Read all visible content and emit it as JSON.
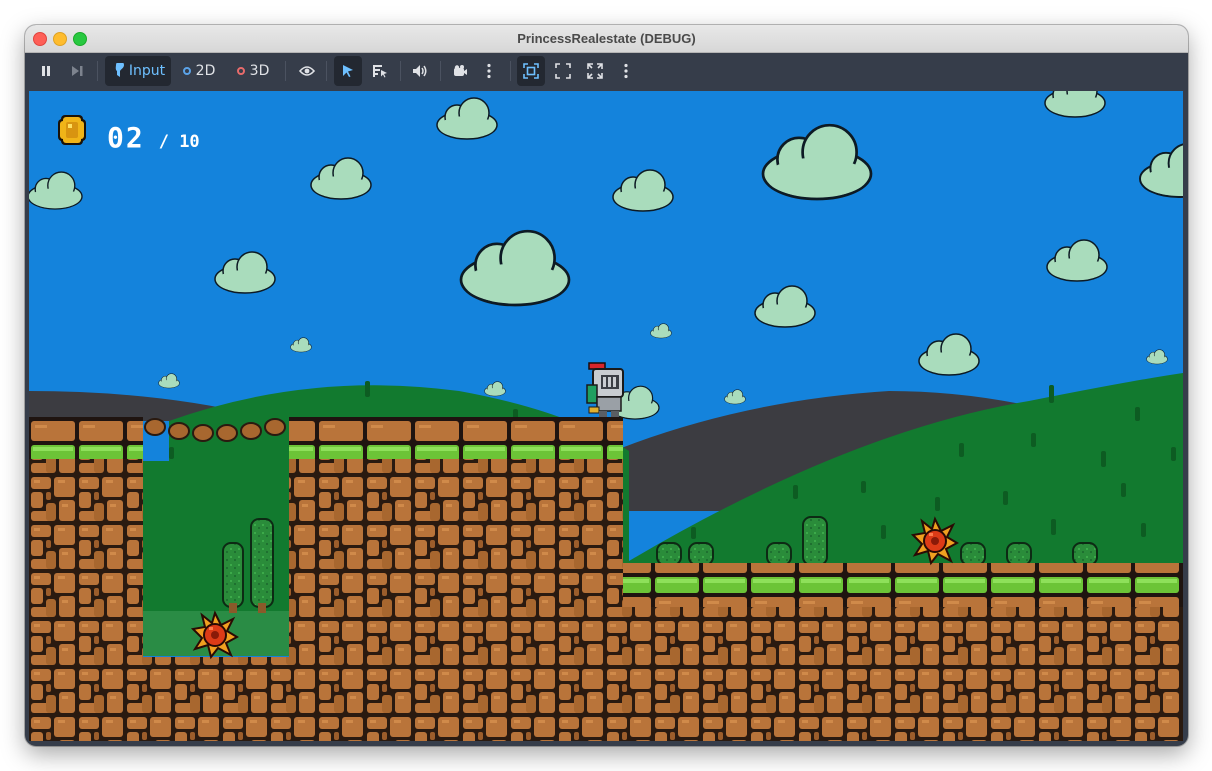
{
  "window": {
    "title": "PrincessRealestate (DEBUG)"
  },
  "toolbar": {
    "pause_icon": "pause-icon",
    "step_icon": "step-forward-icon",
    "input_label": "Input",
    "mode_2d_label": "2D",
    "mode_3d_label": "3D",
    "visibility_icon": "eye-icon",
    "select_icon": "cursor-arrow-icon",
    "list_select_icon": "list-select-icon",
    "audio_icon": "speaker-icon",
    "camera_icon": "camera-override-icon",
    "menu_icon": "kebab-menu-icon",
    "embed_icon": "embed-game-icon",
    "keep_aspect_icon": "keep-aspect-icon",
    "stretch_icon": "stretch-icon",
    "colors": {
      "bar_bg": "#363d4a",
      "active_bg": "#232831",
      "dot_2d": "#5ba3e8",
      "dot_3d": "#e86b6b",
      "input_icon": "#6ec0ff"
    }
  },
  "game": {
    "hud": {
      "coin_icon": "coin-icon",
      "coins_collected": "02",
      "coins_total": "/ 10"
    },
    "colors": {
      "sky": "#1483dc",
      "cloud": "#a9dcbc",
      "hill_dark": "#3c3c41",
      "hill_green": "#127a2f",
      "grass": "#6cc437",
      "dirt": "#b9743a",
      "spike": "#dd3b17"
    },
    "entities": [
      "knight-player",
      "spike-enemy",
      "spike-enemy"
    ]
  }
}
